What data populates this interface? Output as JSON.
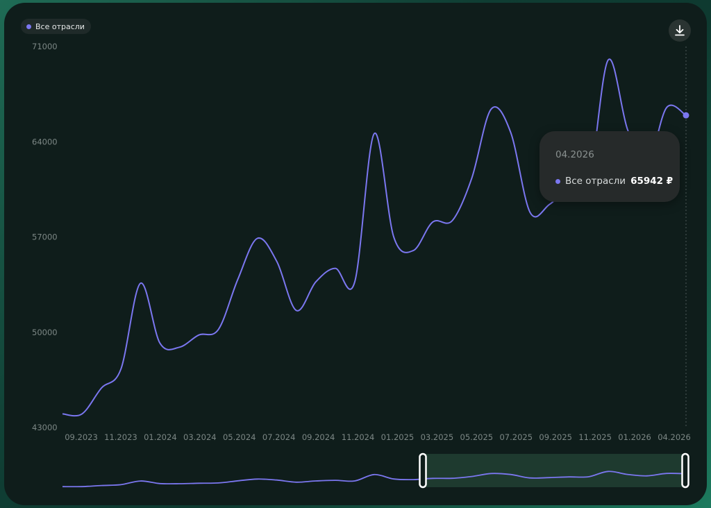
{
  "colors": {
    "series": "#7b77f0",
    "background": "#0f1d1b"
  },
  "legend": {
    "label": "Все отрасли"
  },
  "toolbar": {
    "download_icon": "download-icon"
  },
  "tooltip": {
    "date": "04.2026",
    "series": "Все отрасли",
    "value": "65942 ₽"
  },
  "chart_data": {
    "type": "line",
    "ylim": [
      43000,
      71000
    ],
    "yticks": [
      43000,
      50000,
      57000,
      64000,
      71000
    ],
    "xticks": [
      "09.2023",
      "11.2023",
      "01.2024",
      "03.2024",
      "05.2024",
      "07.2024",
      "09.2024",
      "11.2024",
      "01.2025",
      "03.2025",
      "05.2025",
      "07.2025",
      "09.2025",
      "11.2025",
      "01.2026",
      "04.2026"
    ],
    "categories": [
      "08.2023",
      "09.2023",
      "10.2023",
      "11.2023",
      "12.2023",
      "01.2024",
      "02.2024",
      "03.2024",
      "04.2024",
      "05.2024",
      "06.2024",
      "07.2024",
      "08.2024",
      "09.2024",
      "10.2024",
      "11.2024",
      "12.2024",
      "01.2025",
      "02.2025",
      "03.2025",
      "04.2025",
      "05.2025",
      "06.2025",
      "07.2025",
      "08.2025",
      "09.2025",
      "10.2025",
      "11.2025",
      "12.2025",
      "01.2026",
      "02.2026",
      "03.2026",
      "04.2026"
    ],
    "series": [
      {
        "name": "Все отрасли",
        "values": [
          44000,
          44000,
          45900,
          47300,
          53600,
          49200,
          48900,
          49800,
          50200,
          53900,
          56900,
          55200,
          51600,
          53700,
          54700,
          53700,
          64600,
          57000,
          56000,
          58100,
          58200,
          61300,
          66400,
          64700,
          58800,
          59400,
          60600,
          60800,
          70000,
          64900,
          62300,
          66500,
          65942
        ]
      }
    ],
    "highlight_index": 32
  }
}
